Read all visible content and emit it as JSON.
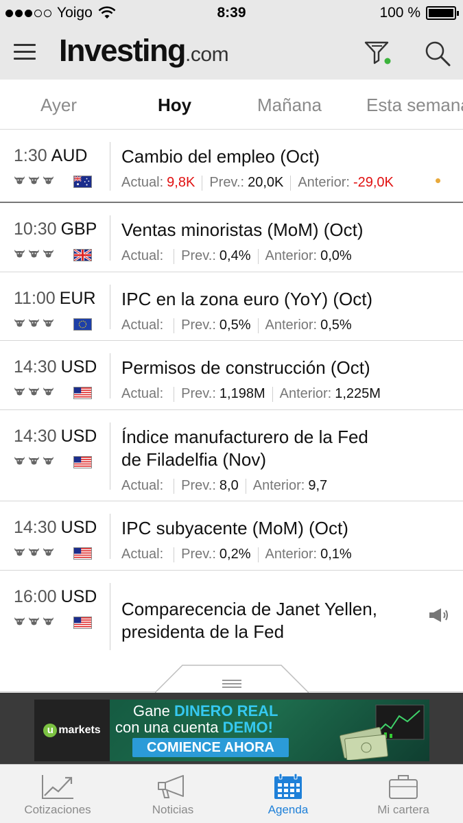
{
  "status_bar": {
    "carrier": "Yoigo",
    "time": "8:39",
    "battery": "100 %"
  },
  "header": {
    "logo_main": "Investing",
    "logo_suffix": ".com"
  },
  "tabs": [
    {
      "label": "Ayer",
      "active": false
    },
    {
      "label": "Hoy",
      "active": true
    },
    {
      "label": "Mañana",
      "active": false
    },
    {
      "label": "Esta semana",
      "active": false
    }
  ],
  "events": [
    {
      "time": "1:30",
      "currency": "AUD",
      "flag": "AU",
      "title": "Cambio del empleo (Oct)",
      "actual_label": "Actual:",
      "actual": "9,8K",
      "prev_label": "Prev.:",
      "prev": "20,0K",
      "anterior_label": "Anterior:",
      "anterior": "-29,0K"
    },
    {
      "time": "10:30",
      "currency": "GBP",
      "flag": "GB",
      "title": "Ventas minoristas (MoM) (Oct)",
      "actual_label": "Actual:",
      "actual": "",
      "prev_label": "Prev.:",
      "prev": "0,4%",
      "anterior_label": "Anterior:",
      "anterior": "0,0%"
    },
    {
      "time": "11:00",
      "currency": "EUR",
      "flag": "EU",
      "title": "IPC en la zona euro (YoY) (Oct)",
      "actual_label": "Actual:",
      "actual": "",
      "prev_label": "Prev.:",
      "prev": "0,5%",
      "anterior_label": "Anterior:",
      "anterior": "0,5%"
    },
    {
      "time": "14:30",
      "currency": "USD",
      "flag": "US",
      "title": "Permisos de construcción (Oct)",
      "actual_label": "Actual:",
      "actual": "",
      "prev_label": "Prev.:",
      "prev": "1,198M",
      "anterior_label": "Anterior:",
      "anterior": "1,225M"
    },
    {
      "time": "14:30",
      "currency": "USD",
      "flag": "US",
      "title_line1": "Índice manufacturero de la Fed",
      "title_line2": "de Filadelfia (Nov)",
      "actual_label": "Actual:",
      "actual": "",
      "prev_label": "Prev.:",
      "prev": "8,0",
      "anterior_label": "Anterior:",
      "anterior": "9,7"
    },
    {
      "time": "14:30",
      "currency": "USD",
      "flag": "US",
      "title": "IPC subyacente (MoM) (Oct)",
      "actual_label": "Actual:",
      "actual": "",
      "prev_label": "Prev.:",
      "prev": "0,2%",
      "anterior_label": "Anterior:",
      "anterior": "0,1%"
    },
    {
      "time": "16:00",
      "currency": "USD",
      "flag": "US",
      "title_line1": "Comparecencia de Janet Yellen,",
      "title_line2": "presidenta de la Fed",
      "icon": "speaker-icon"
    }
  ],
  "ad": {
    "brand": "markets",
    "brand_initial": "u",
    "line1_pre": "Gane ",
    "line1_hl": "DINERO REAL",
    "line2_pre": "con una cuenta ",
    "line2_hl": "DEMO!",
    "cta": "COMIENCE AHORA"
  },
  "bottom_nav": [
    {
      "label": "Cotizaciones",
      "icon": "chart-icon",
      "active": false
    },
    {
      "label": "Noticias",
      "icon": "megaphone-icon",
      "active": false
    },
    {
      "label": "Agenda",
      "icon": "calendar-icon",
      "active": true
    },
    {
      "label": "Mi cartera",
      "icon": "briefcase-icon",
      "active": false
    }
  ],
  "colors": {
    "accent": "#1f80d8",
    "negative": "#e01010",
    "importance_dot": "#e8a93b",
    "header_bg": "#e8e8e8",
    "filter_dot": "#3cb33c"
  }
}
